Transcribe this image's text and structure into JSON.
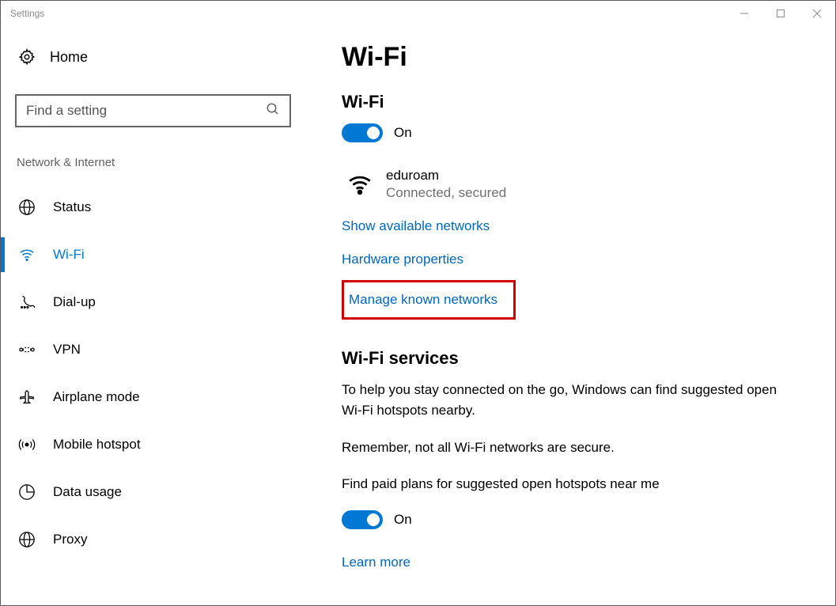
{
  "window": {
    "title": "Settings"
  },
  "sidebar": {
    "home_label": "Home",
    "search_placeholder": "Find a setting",
    "category_label": "Network & Internet",
    "items": [
      {
        "label": "Status"
      },
      {
        "label": "Wi-Fi"
      },
      {
        "label": "Dial-up"
      },
      {
        "label": "VPN"
      },
      {
        "label": "Airplane mode"
      },
      {
        "label": "Mobile hotspot"
      },
      {
        "label": "Data usage"
      },
      {
        "label": "Proxy"
      }
    ]
  },
  "main": {
    "page_title": "Wi-Fi",
    "wifi_section_title": "Wi-Fi",
    "wifi_toggle_state": "On",
    "network": {
      "name": "eduroam",
      "status": "Connected, secured"
    },
    "links": {
      "show_available": "Show available networks",
      "hardware_props": "Hardware properties",
      "manage_known": "Manage known networks"
    },
    "services_title": "Wi-Fi services",
    "services_body1": "To help you stay connected on the go, Windows can find suggested open Wi-Fi hotspots nearby.",
    "services_body2": "Remember, not all Wi-Fi networks are secure.",
    "paid_plans_label": "Find paid plans for suggested open hotspots near me",
    "paid_toggle_state": "On",
    "learn_more": "Learn more"
  }
}
